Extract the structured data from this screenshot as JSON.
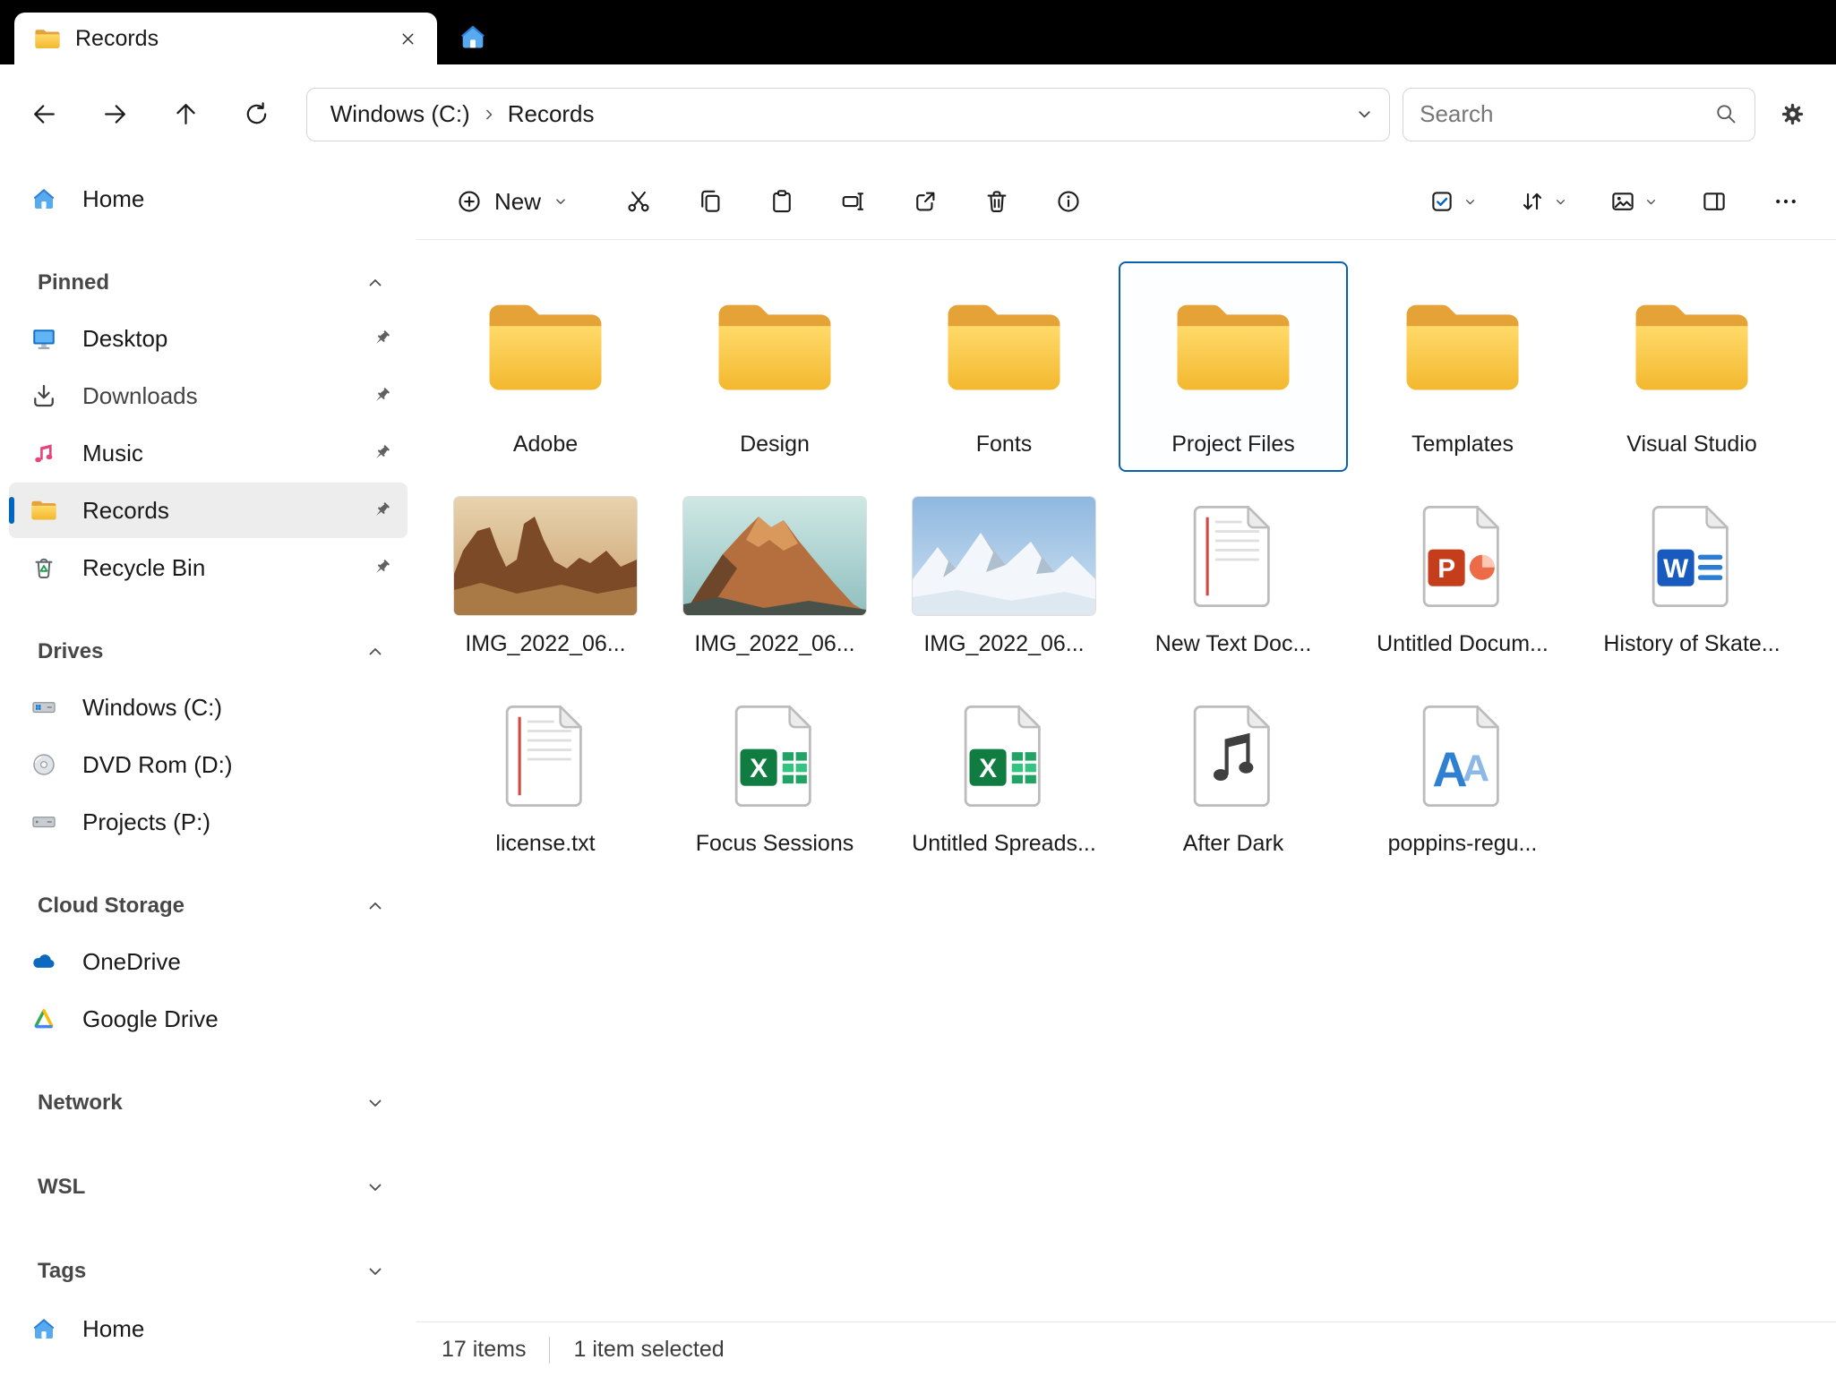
{
  "colors": {
    "accent": "#0067c0",
    "titlebar_bg": "#000000",
    "folder_yellow": "#f3b82e",
    "selection_border": "#0b5fb0"
  },
  "titlebar": {
    "tab_title": "Records"
  },
  "navbar": {
    "nav_icons": [
      "back",
      "forward",
      "up",
      "refresh"
    ],
    "breadcrumb": {
      "root": "Windows (C:)",
      "current": "Records"
    },
    "search_placeholder": "Search"
  },
  "commandbar": {
    "new_label": "New",
    "tool_icons": [
      "cut",
      "copy",
      "paste",
      "rename",
      "share",
      "delete",
      "info"
    ],
    "view_icons": [
      "select",
      "sort",
      "view",
      "details-pane",
      "more"
    ]
  },
  "sidebar": {
    "home": {
      "label": "Home",
      "icon": "home-icon"
    },
    "sections": [
      {
        "label": "Pinned",
        "expanded": true,
        "items": [
          {
            "label": "Desktop",
            "icon": "desktop-icon",
            "pinned": true
          },
          {
            "label": "Downloads",
            "icon": "downloads-icon",
            "pinned": true
          },
          {
            "label": "Music",
            "icon": "music-icon",
            "pinned": true
          },
          {
            "label": "Records",
            "icon": "folder-icon",
            "pinned": true,
            "selected": true
          },
          {
            "label": "Recycle Bin",
            "icon": "recycle-bin-icon",
            "pinned": true
          }
        ]
      },
      {
        "label": "Drives",
        "expanded": true,
        "items": [
          {
            "label": "Windows (C:)",
            "icon": "windows-drive-icon"
          },
          {
            "label": "DVD Rom (D:)",
            "icon": "dvd-drive-icon"
          },
          {
            "label": "Projects (P:)",
            "icon": "drive-icon"
          }
        ]
      },
      {
        "label": "Cloud Storage",
        "expanded": true,
        "items": [
          {
            "label": "OneDrive",
            "icon": "onedrive-icon"
          },
          {
            "label": "Google Drive",
            "icon": "google-drive-icon"
          }
        ]
      },
      {
        "label": "Network",
        "expanded": false,
        "items": []
      },
      {
        "label": "WSL",
        "expanded": false,
        "items": []
      },
      {
        "label": "Tags",
        "expanded": false,
        "items": []
      }
    ],
    "footer": {
      "label": "Home",
      "icon": "home-icon"
    }
  },
  "files": {
    "grid": [
      [
        {
          "name": "Adobe",
          "type": "folder"
        },
        {
          "name": "Design",
          "type": "folder"
        },
        {
          "name": "Fonts",
          "type": "folder"
        },
        {
          "name": "Project Files",
          "type": "folder",
          "selected": true
        },
        {
          "name": "Templates",
          "type": "folder"
        },
        {
          "name": "Visual Studio",
          "type": "folder"
        }
      ],
      [
        {
          "name": "IMG_2022_06...",
          "type": "image",
          "thumb": "desert-rocks"
        },
        {
          "name": "IMG_2022_06...",
          "type": "image",
          "thumb": "sunset-mountain"
        },
        {
          "name": "IMG_2022_06...",
          "type": "image",
          "thumb": "snowy-mountains"
        },
        {
          "name": "New Text Doc...",
          "type": "text-document"
        },
        {
          "name": "Untitled Docum...",
          "type": "powerpoint"
        },
        {
          "name": "History of Skate...",
          "type": "word"
        }
      ],
      [
        {
          "name": "license.txt",
          "type": "text-document"
        },
        {
          "name": "Focus Sessions",
          "type": "excel"
        },
        {
          "name": "Untitled Spreads...",
          "type": "excel"
        },
        {
          "name": "After Dark",
          "type": "audio"
        },
        {
          "name": "poppins-regu...",
          "type": "font-file"
        }
      ]
    ]
  },
  "statusbar": {
    "count": "17 items",
    "selected": "1 item selected"
  }
}
